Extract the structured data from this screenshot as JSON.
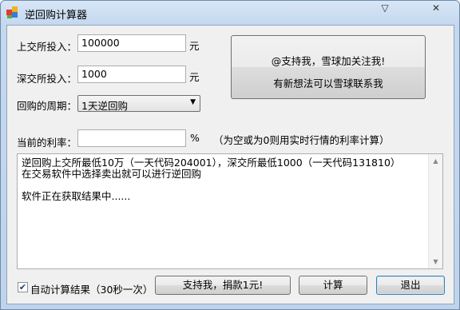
{
  "window": {
    "title": "逆回购计算器",
    "menu_glyph": "▽",
    "close_glyph": "✕"
  },
  "form": {
    "sh_label": "上交所投入：",
    "sh_value": "100000",
    "sh_unit": "元",
    "sz_label": "深交所投入：",
    "sz_value": "1000",
    "sz_unit": "元",
    "period_label": "回购的周期：",
    "period_selected": "1天逆回购",
    "rate_label": "当前的利率：",
    "rate_value": "",
    "rate_unit": "%",
    "rate_note": "（为空或为0则用实时行情的利率计算）"
  },
  "promo": {
    "line1": "@支持我，雪球加关注我!",
    "line2": "有新想法可以雪球联系我"
  },
  "output": {
    "text": "逆回购上交所最低10万（一天代码204001），深交所最低1000（一天代码131810）\n在交易软件中选择卖出就可以进行逆回购\n\n软件正在获取结果中......"
  },
  "footer": {
    "auto_calc_label": "自动计算结果（30秒一次）",
    "auto_calc_checked": true,
    "donate_label": "支持我，捐款1元!",
    "calc_label": "计算",
    "exit_label": "退出"
  },
  "colors": {
    "title_bar": "#c4d8ee",
    "exit_border": "#3c7fb1"
  }
}
